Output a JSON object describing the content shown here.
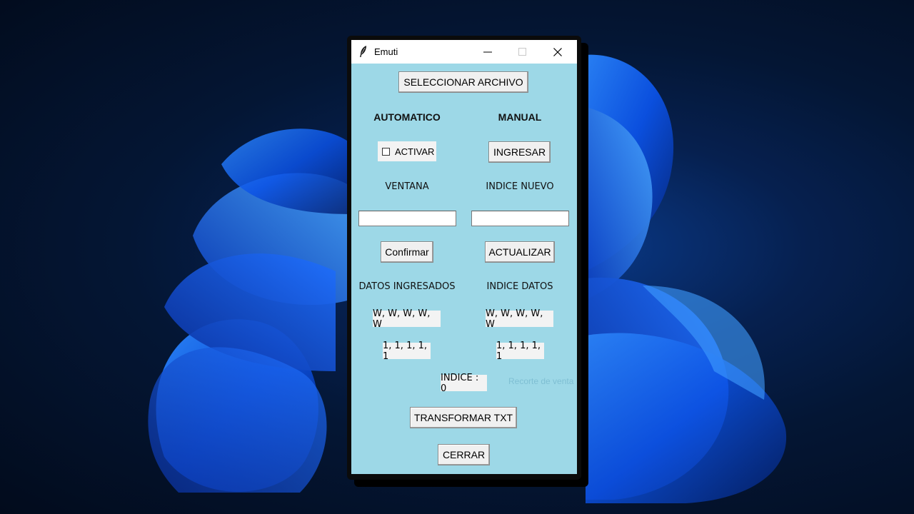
{
  "window": {
    "title": "Emuti",
    "icon": "feather-icon"
  },
  "main": {
    "select_file_label": "SELECCIONAR ARCHIVO",
    "automatic_heading": "AUTOMATICO",
    "manual_heading": "MANUAL",
    "activate_label": "ACTIVAR",
    "activate_checked": false,
    "enter_label": "INGRESAR",
    "window_label": "VENTANA",
    "new_index_label": "INDICE NUEVO",
    "window_value": "",
    "new_index_value": "",
    "confirm_label": "Confirmar",
    "update_label": "ACTUALIZAR",
    "entered_data_label": "DATOS INGRESADOS",
    "index_data_label": "INDICE DATOS",
    "entered_data_letters": "W, W, W, W, W",
    "entered_data_numbers": "1, 1, 1, 1, 1",
    "index_data_letters": "W, W, W, W, W",
    "index_data_numbers": "1, 1, 1, 1, 1",
    "index_status": "INDICE : 0",
    "snip_ghost_text": "Recorte de venta",
    "transform_label": "TRANSFORMAR TXT",
    "close_label": "CERRAR"
  },
  "colors": {
    "client_background": "#9dd8e7",
    "wallpaper_accent": "#1a6dff"
  }
}
